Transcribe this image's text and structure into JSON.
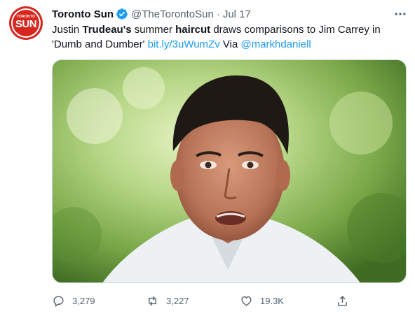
{
  "tweet": {
    "author": {
      "display_name": "Toronto Sun",
      "handle": "@TheTorontoSun",
      "verified": true,
      "avatar_text_top": "TORONTO",
      "avatar_text_main": "SUN"
    },
    "separator": "·",
    "date": "Jul 17",
    "text": {
      "part1": "Justin ",
      "bold1": "Trudeau's",
      "part2": " summer ",
      "bold2": "haircut",
      "part3": " draws comparisons to Jim Carrey in 'Dumb and Dumber' ",
      "link": "bit.ly/3uWumZv",
      "part4": " Via ",
      "mention": "@markhdaniell"
    },
    "media": {
      "description_icon": "photo-image"
    },
    "actions": {
      "reply_count": "3,279",
      "retweet_count": "3,227",
      "like_count": "19.3K"
    }
  },
  "colors": {
    "link": "#1d9bf0",
    "secondary_text": "#536471",
    "brand_red": "#d7261e"
  }
}
